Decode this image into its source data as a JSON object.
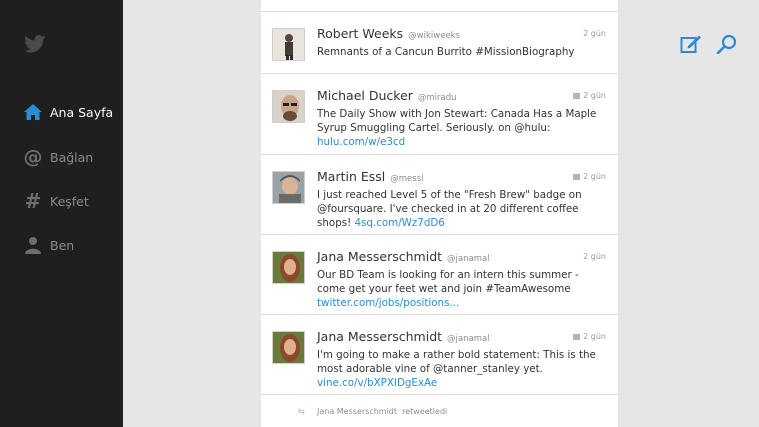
{
  "sidebar": {
    "logo": "twitter-bird-icon",
    "items": [
      {
        "label": "Ana Sayfa",
        "icon": "home-icon",
        "active": true
      },
      {
        "label": "Bağlan",
        "icon": "at-icon",
        "active": false
      },
      {
        "label": "Keşfet",
        "icon": "hash-icon",
        "active": false
      },
      {
        "label": "Ben",
        "icon": "person-icon",
        "active": false
      }
    ]
  },
  "actions": {
    "compose_icon": "compose-icon",
    "search_icon": "search-icon"
  },
  "colors": {
    "sidebar_bg": "#1f1f1f",
    "accent": "#2a8cd5",
    "page_bg": "#e6e6e6"
  },
  "tweets": [
    {
      "name": "Robert Weeks",
      "handle": "@wikiweeks",
      "time": "2 gün",
      "text": "Remnants of a Cancun Burrito #MissionBiography",
      "link": ""
    },
    {
      "name": "Michael Ducker",
      "handle": "@miradu",
      "time": "2 gün",
      "text": "The Daily Show with Jon Stewart: Canada Has a Maple Syrup Smuggling Cartel. Seriously. on @hulu: ",
      "link": "hulu.com/w/e3cd"
    },
    {
      "name": "Martin Essl",
      "handle": "@messl",
      "time": "2 gün",
      "text": "I just reached Level 5 of the \"Fresh Brew\" badge on @foursquare. I've checked in at 20 different coffee shops! ",
      "link": "4sq.com/Wz7dD6"
    },
    {
      "name": "Jana Messerschmidt",
      "handle": "@janamal",
      "time": "2 gün",
      "text": "Our BD Team is looking for an intern this summer - come get your feet wet and join #TeamAwesome ",
      "link": "twitter.com/jobs/positions..."
    },
    {
      "name": "Jana Messerschmidt",
      "handle": "@janamal",
      "time": "2 gün",
      "text": "I'm going to make a rather bold statement: This is the most adorable vine of @tanner_stanley yet. ",
      "link": "vine.co/v/bXPXIDgExAe"
    }
  ],
  "retweet_notice": {
    "name": "Jana Messerschmidt",
    "action": "retweetledi"
  }
}
